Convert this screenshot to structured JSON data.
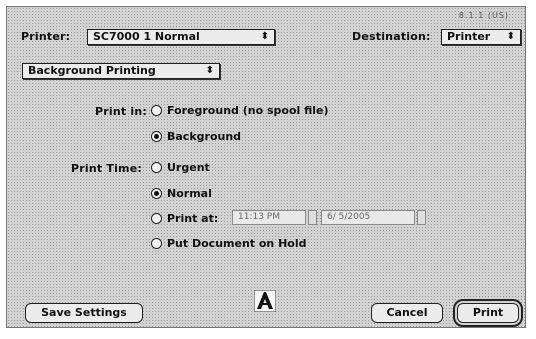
{
  "header": {
    "version": "8.1.1 (US)",
    "printer_label": "Printer:",
    "printer_value": "SC7000 1 Normal",
    "destination_label": "Destination:",
    "destination_value": "Printer"
  },
  "panel_popup": {
    "value": "Background Printing"
  },
  "print_in": {
    "label": "Print in:",
    "options": [
      "Foreground (no spool file)",
      "Background"
    ],
    "selected": "Background"
  },
  "print_time": {
    "label": "Print Time:",
    "options": [
      "Urgent",
      "Normal",
      "Print at:",
      "Put Document on Hold"
    ],
    "selected": "Normal",
    "time_value": "11:13 PM",
    "date_value": "6/ 5/2005"
  },
  "footer": {
    "save_settings": "Save Settings",
    "cancel": "Cancel",
    "print": "Print"
  },
  "icons": {
    "logo": "adobe-logo-icon",
    "popup_arrow": "popup-arrows-icon"
  }
}
